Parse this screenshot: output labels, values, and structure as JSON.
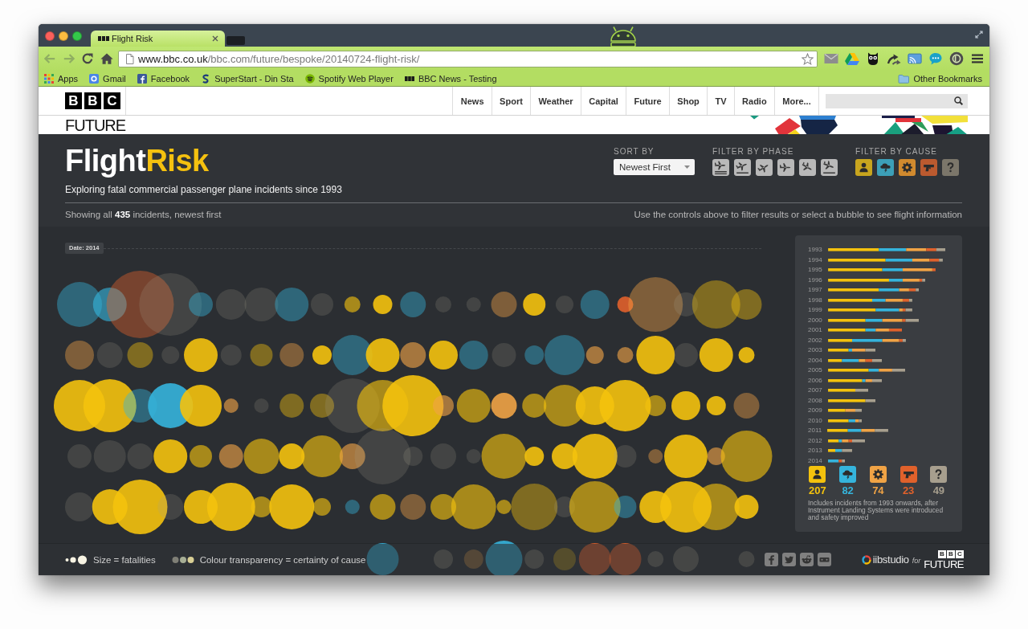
{
  "browser": {
    "tab": {
      "title": "Flight Risk"
    },
    "back": {
      "disabled": true
    },
    "forward": {
      "disabled": true
    },
    "address": {
      "host": "www.bbc.co.uk",
      "path": "/bbc.com/future/bespoke/20140724-flight-risk/"
    },
    "bookmarks": [
      {
        "label": "Apps"
      },
      {
        "label": "Gmail"
      },
      {
        "label": "Facebook"
      },
      {
        "label": "SuperStart - Din Sta"
      },
      {
        "label": "Spotify Web Player"
      },
      {
        "label": "BBC News - Testing"
      }
    ],
    "other_bookmarks": {
      "label": "Other Bookmarks"
    }
  },
  "site_header": {
    "logo": [
      "B",
      "B",
      "C"
    ],
    "section": "FUTURE",
    "nav": [
      {
        "label": "News"
      },
      {
        "label": "Sport"
      },
      {
        "label": "Weather"
      },
      {
        "label": "Capital"
      },
      {
        "label": "Future"
      },
      {
        "label": "Shop"
      },
      {
        "label": "TV"
      },
      {
        "label": "Radio"
      },
      {
        "label": "More..."
      }
    ]
  },
  "app": {
    "title": {
      "lead": "Flight",
      "accent": "Risk"
    },
    "subtitle": "Exploring fatal commercial passenger plane incidents since 1993",
    "sort": {
      "label": "SORT BY",
      "value": "Newest First"
    },
    "phase_filter": {
      "label": "FILTER BY PHASE"
    },
    "cause_filter": {
      "label": "FILTER BY CAUSE",
      "causes": [
        {
          "color": "#c8a51e"
        },
        {
          "color": "#3c9fb7"
        },
        {
          "color": "#d08a2e"
        },
        {
          "color": "#bb5a2f"
        },
        {
          "color": "#7b766a"
        }
      ]
    },
    "summary": "Showing all **435** incidents, newest first",
    "hint": "Use the controls above to filter results or select a bubble to see flight information"
  },
  "timeline": {
    "date_label": "Date: 2014"
  },
  "year_panel": {
    "years": [
      "1993",
      "1994",
      "1995",
      "1996",
      "1997",
      "1998",
      "1999",
      "2000",
      "2001",
      "2002",
      "2003",
      "2004",
      "2005",
      "2006",
      "2007",
      "2008",
      "2009",
      "2010",
      "2011",
      "2012",
      "2013",
      "2014"
    ],
    "causes": [
      {
        "count": "207",
        "color": "#f4c20d"
      },
      {
        "count": "82",
        "color": "#35b4dc"
      },
      {
        "count": "74",
        "color": "#f0a345"
      },
      {
        "count": "23",
        "color": "#e0612b"
      },
      {
        "count": "49",
        "color": "#a79f8e"
      }
    ],
    "note": "Includes incidents from 1993 onwards, after Instrument Landing Systems were introduced and safety improved"
  },
  "footer": {
    "legend": [
      {
        "label": "Size = fatalities"
      },
      {
        "label": "Colour transparency = certainty of cause"
      }
    ],
    "brand": {
      "studio": "iibstudio",
      "joiner": "for",
      "partner_logo": [
        "B",
        "B",
        "C"
      ],
      "partner_section": "FUTURE"
    }
  }
}
